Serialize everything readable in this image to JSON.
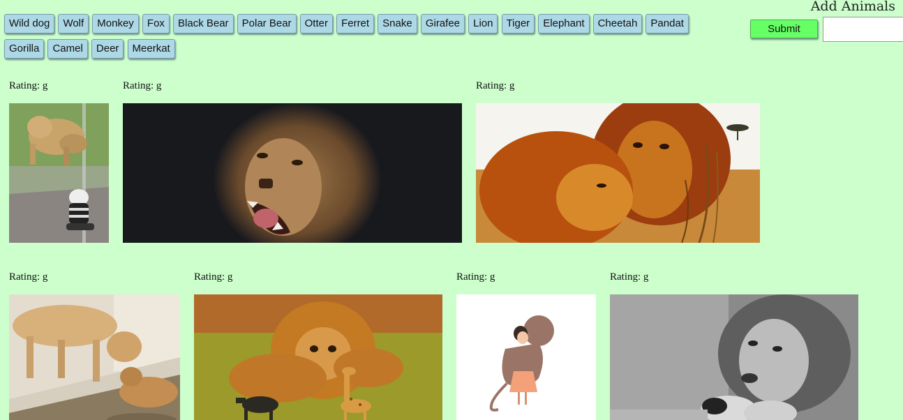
{
  "animals": [
    "Wild dog",
    "Wolf",
    "Monkey",
    "Fox",
    "Black Bear",
    "Polar Bear",
    "Otter",
    "Ferret",
    "Snake",
    "Girafee",
    "Lion",
    "Tiger",
    "Elephant",
    "Cheetah",
    "Pandat",
    "Gorilla",
    "Camel",
    "Deer",
    "Meerkat"
  ],
  "form": {
    "title": "Add Animals",
    "submit_label": "Submit",
    "input_value": ""
  },
  "gifs": [
    {
      "rating": "Rating: g",
      "alt": "lioness with toddler at zoo glass"
    },
    {
      "rating": "Rating: g",
      "alt": "roaring lion on dark background"
    },
    {
      "rating": "Rating: g",
      "alt": "two lions in golden grass"
    },
    {
      "rating": "Rating: g",
      "alt": "lioness licking cub at water"
    },
    {
      "rating": "Rating: g",
      "alt": "cat in lion mane with toy animals"
    },
    {
      "rating": "Rating: g",
      "alt": "illustration of girl hugging lion"
    },
    {
      "rating": "Rating: g",
      "alt": "black and white lion lying down"
    }
  ]
}
